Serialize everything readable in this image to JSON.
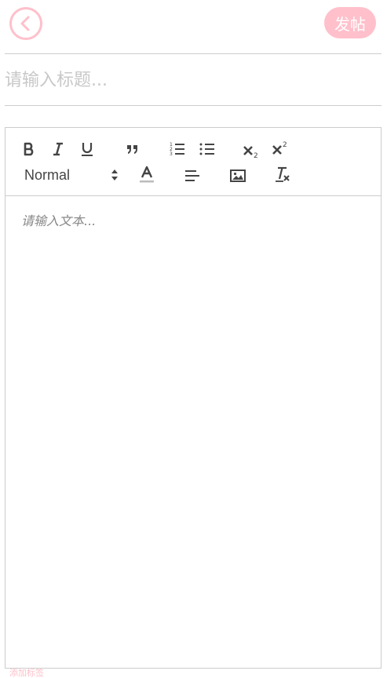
{
  "header": {
    "back_icon": "chevron-left-icon",
    "post_label": "发帖",
    "accent_color": "#ffc0cb"
  },
  "title": {
    "placeholder": "请输入标题..."
  },
  "toolbar": {
    "buttons": [
      "bold",
      "italic",
      "underline",
      "blockquote",
      "ordered-list",
      "bullet-list",
      "subscript",
      "superscript",
      "text-color",
      "align",
      "image",
      "clear-format"
    ],
    "format_value": "Normal"
  },
  "editor": {
    "placeholder": "请输入文本..."
  },
  "footer": {
    "tag_hint": "添加标签"
  }
}
